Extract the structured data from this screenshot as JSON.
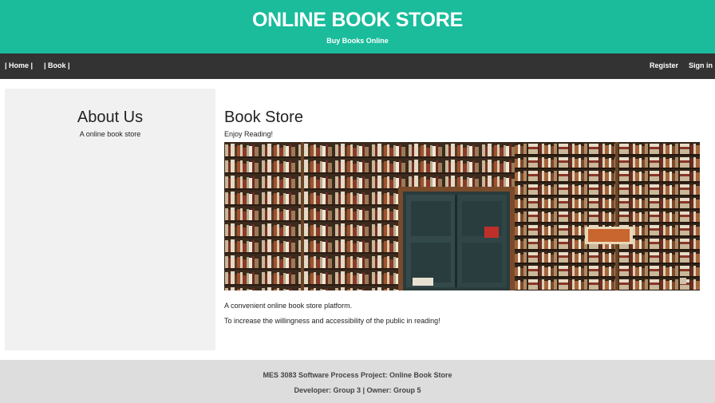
{
  "header": {
    "title": "ONLINE BOOK STORE",
    "subtitle": "Buy Books Online"
  },
  "nav": {
    "home": "| Home |",
    "book": "| Book |",
    "register": "Register",
    "signin": "Sign in"
  },
  "sidebar": {
    "title": "About Us",
    "text": "A online book store"
  },
  "main": {
    "title": "Book Store",
    "tagline": "Enjoy Reading!",
    "desc1": "A convenient online book store platform.",
    "desc2": "To increase the willingness and accessibility of the public in reading!"
  },
  "footer": {
    "line1": "MES 3083 Software Process Project: Online Book Store",
    "line2": "Developer: Group 3 | Owner: Group 5"
  }
}
